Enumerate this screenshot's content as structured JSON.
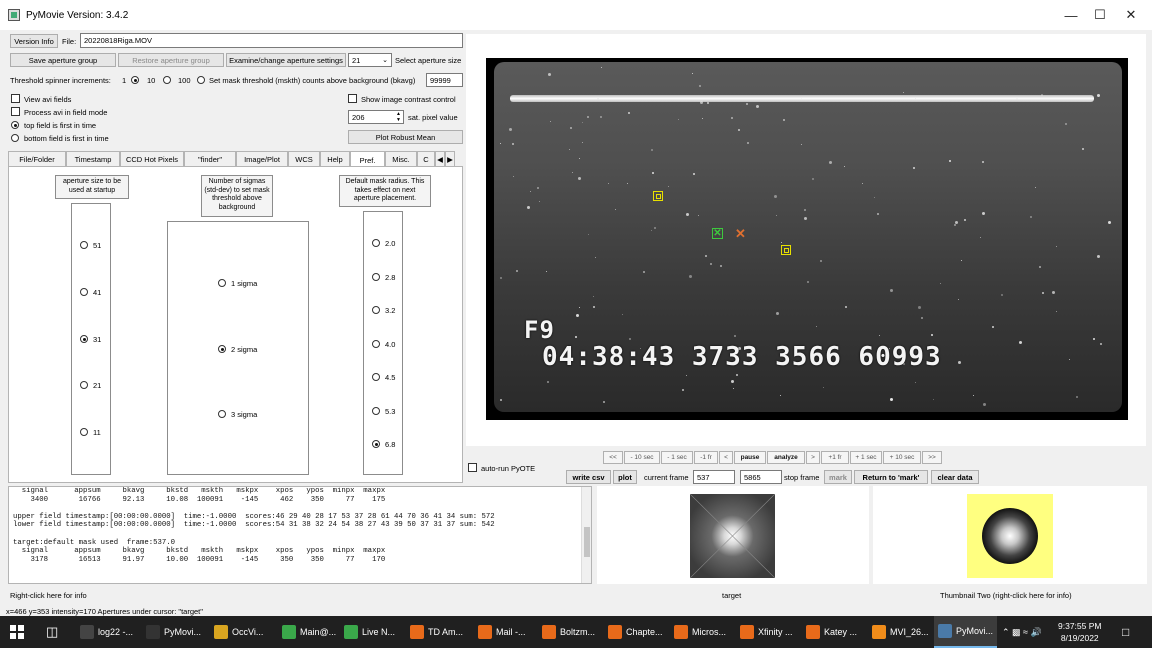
{
  "window": {
    "title": "PyMovie  Version: 3.4.2"
  },
  "toolbar": {
    "version_info": "Version Info",
    "file_label": "File:",
    "file_value": "20220818Riga.MOV",
    "save_group": "Save aperture group",
    "restore_group": "Restore aperture group",
    "examine_settings": "Examine/change aperture settings",
    "aperture_size_value": "21",
    "select_aperture_size": "Select aperture size",
    "threshold_label": "Threshold spinner increments:",
    "inc_1": "1",
    "inc_10": "10",
    "inc_100": "100",
    "mask_threshold_label": "Set mask threshold (mskth) counts above background (bkavg)",
    "mask_threshold_value": "99999",
    "view_avi_fields": "View avi fields",
    "process_field_mode": "Process avi in field mode",
    "top_field_first": "top field is first in time",
    "bottom_field_first": "bottom field is first in time",
    "show_contrast": "Show image contrast control",
    "sat_value": "206",
    "sat_label": "sat. pixel value",
    "plot_robust_mean": "Plot Robust Mean"
  },
  "tabs": [
    "File/Folder",
    "Timestamp",
    "CCD Hot Pixels",
    "\"finder\"",
    "Image/Plot",
    "WCS",
    "Help",
    "Pref.",
    "Misc.",
    "C"
  ],
  "active_tab": "Pref.",
  "pref": {
    "aperture_note": "aperture size to be used at startup",
    "aperture_options": [
      "51",
      "41",
      "31",
      "21",
      "11"
    ],
    "aperture_selected": "31",
    "sigma_note": "Number of sigmas (std-dev) to set mask threshold above background",
    "sigma_options": [
      "1 sigma",
      "2 sigma",
      "3 sigma"
    ],
    "sigma_selected": "2 sigma",
    "radius_note": "Default mask radius. This takes effect on next aperture placement.",
    "radius_options": [
      "2.0",
      "2.8",
      "3.2",
      "4.0",
      "4.5",
      "5.3",
      "6.8"
    ],
    "radius_selected": "6.8"
  },
  "video": {
    "overlay_line1": "F9",
    "overlay_line2": "04:38:43  3733  3566  60993"
  },
  "nav": {
    "buttons": [
      "<<",
      "- 10 sec",
      "- 1 sec",
      "-1 fr",
      "<",
      "pause",
      "analyze",
      ">",
      "+1 fr",
      "+ 1 sec",
      "+ 10 sec",
      ">>"
    ],
    "auto_run": "auto-run PyOTE",
    "write_csv": "write csv",
    "plot": "plot",
    "current_frame_label": "current frame",
    "current_frame": "537",
    "stop_frame_value": "5865",
    "stop_frame_label": "stop frame",
    "mark": "mark",
    "return_mark": "Return to 'mark'",
    "clear_data": "clear data"
  },
  "log_lines": [
    "  signal      appsum     bkavg     bkstd   mskth   mskpx    xpos   ypos  minpx  maxpx",
    "    3400       16766     92.13     10.08  100091    -145     462    350     77    175",
    "",
    "upper field timestamp:[00:00:00.0000]  time:-1.0000  scores:46 29 40 28 17 53 37 28 61 44 70 36 41 34 sum: 572",
    "lower field timestamp:[00:00:00.0000]  time:-1.0000  scores:54 31 38 32 24 54 38 27 43 39 50 37 31 37 sum: 542",
    "",
    "target:default mask used  frame:537.0",
    "  signal      appsum     bkavg     bkstd   mskth   mskpx    xpos   ypos  minpx  maxpx",
    "    3178       16513     91.97     10.00  100091    -145     350    350     77    170"
  ],
  "thumbs": {
    "target_label": "target",
    "thumb_two_label": "Thumbnail Two (right-click here for info)"
  },
  "status": {
    "right_click_info": "Right-click here for info",
    "cursor": "x=466 y=353 intensity=170   Apertures under cursor: \"target\""
  },
  "taskbar": {
    "items": [
      "log22 -...",
      "PyMovi...",
      "OccVi...",
      "Main@...",
      "Live N...",
      "TD Am...",
      "Mail -...",
      "Boltzm...",
      "Chapte...",
      "Micros...",
      "Xfinity ...",
      "Katey ...",
      "MVI_26...",
      "PyMovi..."
    ],
    "time": "9:37:55 PM",
    "date": "8/19/2022"
  },
  "colors": {
    "aperture_yellow": "#e8e000",
    "target_green": "#3ec83e",
    "cursor_orange": "#e07030",
    "thumb_bg": "#ffff80"
  }
}
